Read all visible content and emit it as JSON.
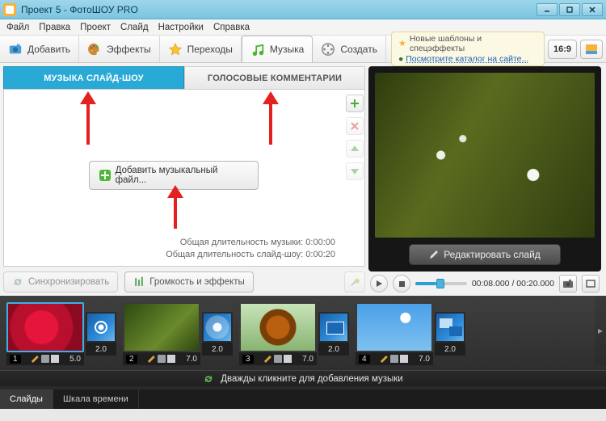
{
  "window": {
    "title": "Проект 5 - ФотоШОУ PRO"
  },
  "menu": {
    "file": "Файл",
    "edit": "Правка",
    "project": "Проект",
    "slide": "Слайд",
    "settings": "Настройки",
    "help": "Справка"
  },
  "toolbar": {
    "add": "Добавить",
    "effects": "Эффекты",
    "transitions": "Переходы",
    "music": "Музыка",
    "create": "Создать"
  },
  "promo": {
    "line1": "Новые шаблоны и спецэффекты",
    "link": "Посмотрите каталог на сайте..."
  },
  "aspect": "16:9",
  "music_tabs": {
    "slideshow_music": "МУЗЫКА СЛАЙД-ШОУ",
    "voice_comments": "ГОЛОСОВЫЕ КОММЕНТАРИИ"
  },
  "music_panel": {
    "add_file": "Добавить музыкальный файл...",
    "total_music": "Общая длительность музыки: 0:00:00",
    "total_show": "Общая длительность слайд-шоу: 0:00:20",
    "sync": "Синхронизировать",
    "volume_fx": "Громкость и эффекты"
  },
  "preview": {
    "edit_slide": "Редактировать слайд",
    "time": "00:08.000 / 00:20.000"
  },
  "timeline": {
    "hint": "Дважды кликните для добавления музыки",
    "slides": [
      {
        "index": "1",
        "duration": "5.0",
        "trans": "2.0",
        "img": "rose",
        "active": true
      },
      {
        "index": "2",
        "duration": "7.0",
        "trans": "2.0",
        "img": "leaf",
        "active": false
      },
      {
        "index": "3",
        "duration": "7.0",
        "trans": "2.0",
        "img": "bfly",
        "active": false
      },
      {
        "index": "4",
        "duration": "7.0",
        "trans": "2.0",
        "img": "sky",
        "active": false
      }
    ]
  },
  "bottom_tabs": {
    "slides": "Слайды",
    "timeline": "Шкала времени"
  }
}
